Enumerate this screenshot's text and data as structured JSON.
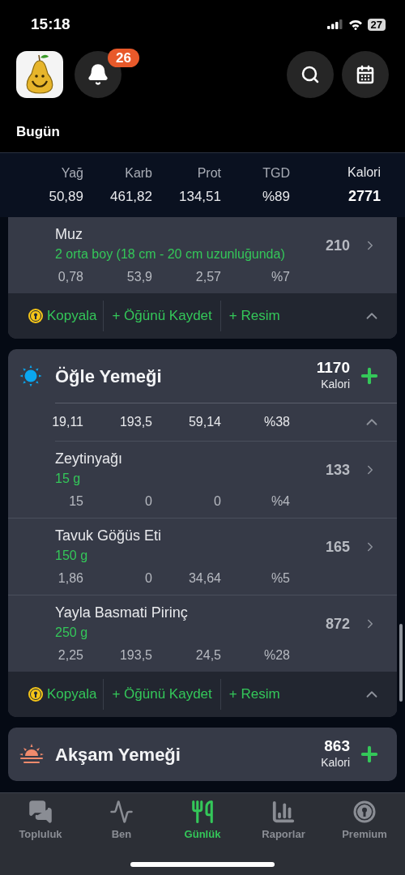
{
  "status_bar": {
    "time": "15:18",
    "battery": "27"
  },
  "header": {
    "notifications": "26",
    "title": "Bugün"
  },
  "summary": {
    "columns": [
      {
        "label": "Yağ",
        "value": "50,89"
      },
      {
        "label": "Karb",
        "value": "461,82"
      },
      {
        "label": "Prot",
        "value": "134,51"
      },
      {
        "label": "TGD",
        "value": "%89"
      }
    ],
    "calories": {
      "label": "Kalori",
      "value": "2771"
    }
  },
  "meals": [
    {
      "kind": "partial",
      "items": [
        {
          "name": "Muz",
          "amount": "2 orta boy (18 cm - 20 cm uzunluğunda)",
          "calories": "210",
          "macros": [
            "0,78",
            "53,9",
            "2,57",
            "%7"
          ]
        }
      ],
      "footer": {
        "copy": "Kopyala",
        "save": "+ Öğünü Kaydet",
        "photo": "+ Resim"
      },
      "expanded": true
    },
    {
      "kind": "lunch",
      "title": "Öğle Yemeği",
      "calories": "1170",
      "calories_label": "Kalori",
      "totals": [
        "19,11",
        "193,5",
        "59,14",
        "%38"
      ],
      "expanded": true,
      "items": [
        {
          "name": "Zeytinyağı",
          "amount": "15 g",
          "calories": "133",
          "macros": [
            "15",
            "0",
            "0",
            "%4"
          ]
        },
        {
          "name": "Tavuk Göğüs Eti",
          "amount": "150 g",
          "calories": "165",
          "macros": [
            "1,86",
            "0",
            "34,64",
            "%5"
          ]
        },
        {
          "name": "Yayla Basmati Pirinç",
          "amount": "250 g",
          "calories": "872",
          "macros": [
            "2,25",
            "193,5",
            "24,5",
            "%28"
          ]
        }
      ],
      "footer": {
        "copy": "Kopyala",
        "save": "+ Öğünü Kaydet",
        "photo": "+ Resim"
      }
    },
    {
      "kind": "dinner",
      "title": "Akşam Yemeği",
      "calories": "863",
      "calories_label": "Kalori"
    }
  ],
  "tab_bar": [
    {
      "kind": "community",
      "label": "Topluluk",
      "selected": false
    },
    {
      "kind": "me",
      "label": "Ben",
      "selected": false
    },
    {
      "kind": "diary",
      "label": "Günlük",
      "selected": true
    },
    {
      "kind": "reports",
      "label": "Raporlar",
      "selected": false
    },
    {
      "kind": "premium",
      "label": "Premium",
      "selected": false
    }
  ]
}
